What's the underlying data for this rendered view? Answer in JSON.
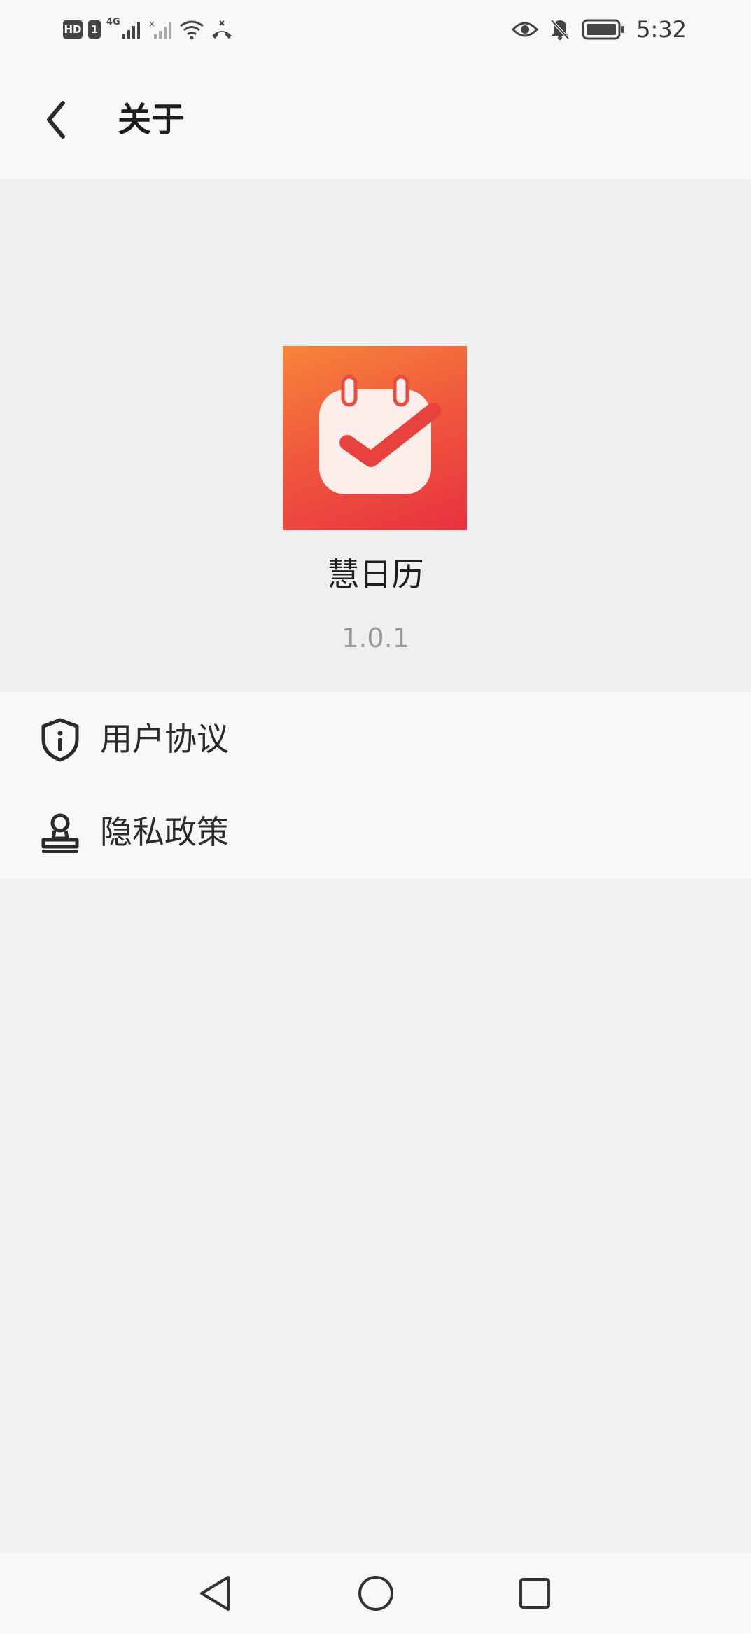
{
  "status_bar": {
    "hd_label": "HD",
    "sim_label": "1",
    "network_label": "4G",
    "time": "5:32",
    "icons": [
      "hd-icon",
      "sim-icon",
      "signal-icon",
      "signal-no-sim-icon",
      "wifi-icon",
      "missed-call-icon",
      "eye-icon",
      "bell-muted-icon",
      "battery-icon"
    ]
  },
  "header": {
    "title": "关于",
    "back_icon": "chevron-left-icon"
  },
  "app": {
    "name": "慧日历",
    "version": "1.0.1",
    "icon": "calendar-check-icon",
    "colors": {
      "icon_gradient_top": "#f7853a",
      "icon_gradient_bottom": "#e8323f"
    }
  },
  "menu": {
    "items": [
      {
        "label": "用户协议",
        "icon": "shield-info-icon"
      },
      {
        "label": "隐私政策",
        "icon": "user-stamp-icon"
      }
    ]
  },
  "nav_bar": {
    "icons": [
      "back-triangle-icon",
      "home-circle-icon",
      "recents-square-icon"
    ]
  }
}
